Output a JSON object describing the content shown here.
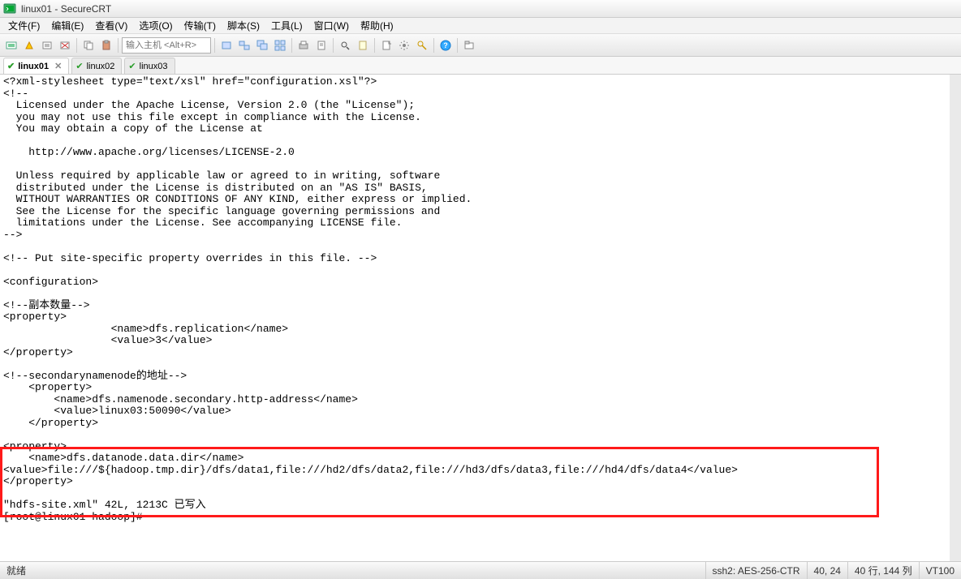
{
  "window": {
    "title": "linux01 - SecureCRT"
  },
  "menu": {
    "file": "文件(F)",
    "edit": "编辑(E)",
    "view": "查看(V)",
    "options": "选项(O)",
    "transfer": "传输(T)",
    "script": "脚本(S)",
    "tools": "工具(L)",
    "window": "窗口(W)",
    "help": "帮助(H)"
  },
  "toolbar": {
    "host_placeholder": "输入主机 <Alt+R>"
  },
  "tabs": [
    {
      "label": "linux01",
      "active": true
    },
    {
      "label": "linux02",
      "active": false
    },
    {
      "label": "linux03",
      "active": false
    }
  ],
  "terminal": {
    "lines": [
      "<?xml-stylesheet type=\"text/xsl\" href=\"configuration.xsl\"?>",
      "<!--",
      "  Licensed under the Apache License, Version 2.0 (the \"License\");",
      "  you may not use this file except in compliance with the License.",
      "  You may obtain a copy of the License at",
      "",
      "    http://www.apache.org/licenses/LICENSE-2.0",
      "",
      "  Unless required by applicable law or agreed to in writing, software",
      "  distributed under the License is distributed on an \"AS IS\" BASIS,",
      "  WITHOUT WARRANTIES OR CONDITIONS OF ANY KIND, either express or implied.",
      "  See the License for the specific language governing permissions and",
      "  limitations under the License. See accompanying LICENSE file.",
      "-->",
      "",
      "<!-- Put site-specific property overrides in this file. -->",
      "",
      "<configuration>",
      "",
      "<!--副本数量-->",
      "<property>",
      "                 <name>dfs.replication</name>",
      "                 <value>3</value>",
      "</property>",
      "",
      "<!--secondarynamenode的地址-->",
      "    <property>",
      "        <name>dfs.namenode.secondary.http-address</name>",
      "        <value>linux03:50090</value>",
      "    </property>",
      "",
      "<property>",
      "    <name>dfs.datanode.data.dir</name>",
      "<value>file:///${hadoop.tmp.dir}/dfs/data1,file:///hd2/dfs/data2,file:///hd3/dfs/data3,file:///hd4/dfs/data4</value>",
      "</property>",
      "",
      "\"hdfs-site.xml\" 42L, 1213C 已写入",
      "[root@linux01 hadoop]#"
    ]
  },
  "status": {
    "ready": "就绪",
    "protocol": "ssh2: AES-256-CTR",
    "cursor": "40, 24",
    "size": "40 行, 144 列",
    "emu": "VT100"
  }
}
